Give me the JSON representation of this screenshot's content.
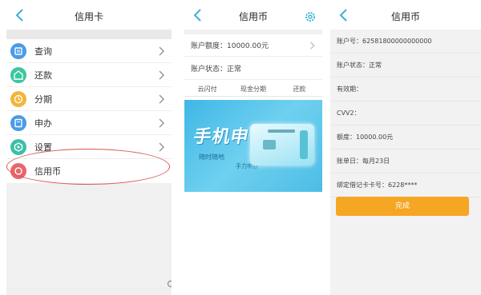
{
  "colors": {
    "accent": "#3cb0d9",
    "button": "#f5a623",
    "highlight": "#d9534f"
  },
  "panel1": {
    "title": "信用卡",
    "menu": [
      {
        "label": "查询",
        "icon": "query-icon",
        "color": "#4a9be6"
      },
      {
        "label": "还款",
        "icon": "repay-icon",
        "color": "#3cc7a0"
      },
      {
        "label": "分期",
        "icon": "installment-icon",
        "color": "#f4b43a"
      },
      {
        "label": "申办",
        "icon": "apply-icon",
        "color": "#4a9be6"
      },
      {
        "label": "设置",
        "icon": "settings-icon",
        "color": "#3cbfa8"
      },
      {
        "label": "信用币",
        "icon": "credit-coin-icon",
        "color": "#e8666a"
      }
    ]
  },
  "panel2": {
    "title": "信用币",
    "limit": "账户额度：10000.00元",
    "status": "账户状态：正常",
    "tabs": [
      "云闪付",
      "现金分期",
      "还款"
    ],
    "banner_title": "手机申请",
    "banner_sub1": "随时随地",
    "banner_sub2": "手力申办"
  },
  "panel3": {
    "title": "信用币",
    "rows": [
      "账户号：62581800000000000",
      "账户状态：正常",
      "有效期：",
      "CVV2：",
      "额度：10000.00元",
      "账单日：每月23日",
      "绑定借记卡卡号：6228****"
    ],
    "done": "完成"
  }
}
